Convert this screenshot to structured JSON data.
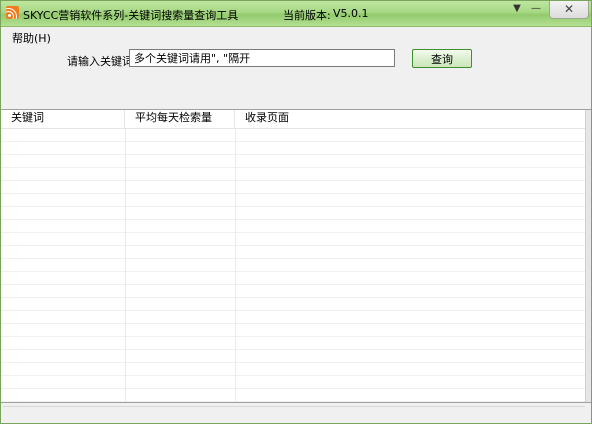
{
  "window": {
    "title": "SKYCC营销软件系列-关键词搜索量查询工具",
    "version_label": "当前版本:",
    "version_value": "V5.0.1",
    "icon": "rss-feed-icon",
    "controls": {
      "dropdown_glyph": "▼",
      "minimize_glyph": "—",
      "close_glyph": "✕"
    }
  },
  "menu": {
    "items": [
      {
        "label": "帮助(H)"
      }
    ]
  },
  "search": {
    "label": "请输入关键词",
    "value": "多个关键词请用\", \"隔开",
    "button_label": "查询"
  },
  "table": {
    "columns": [
      "关键词",
      "平均每天检索量",
      "收录页面"
    ],
    "rows": []
  },
  "status": {
    "text": ""
  },
  "colors": {
    "titlebar": "#a6d884",
    "button_border": "#3e8f2f",
    "icon_orange": "#ee7d1f"
  }
}
